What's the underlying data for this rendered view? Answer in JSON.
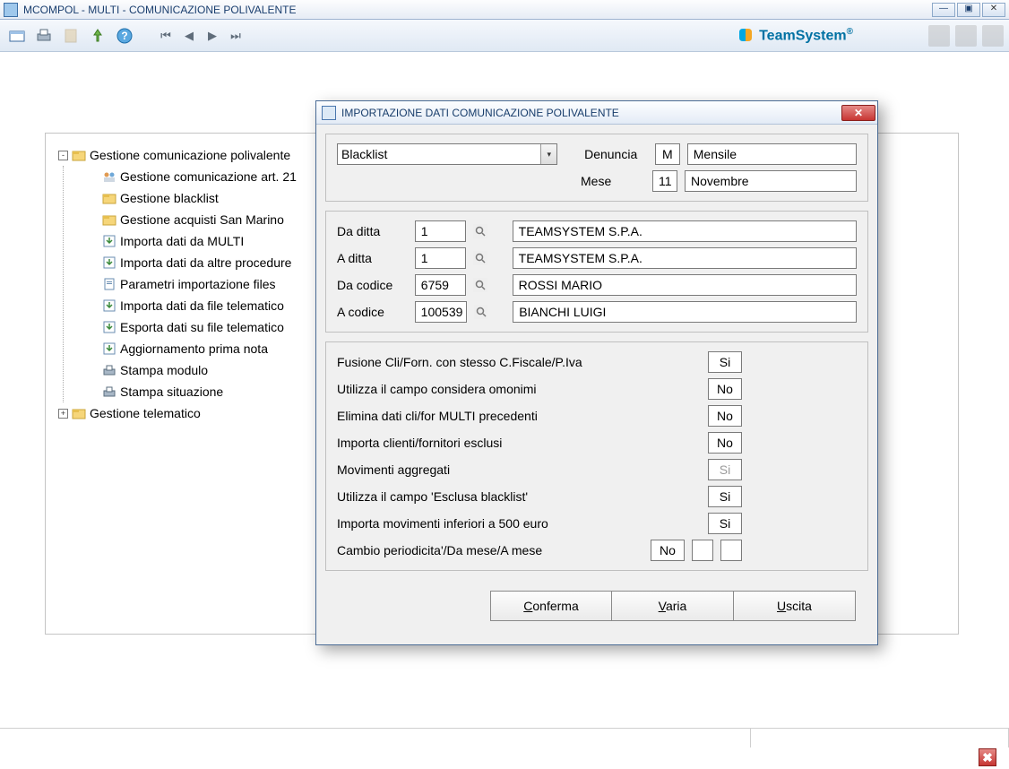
{
  "window": {
    "app_code": "MCOMPOL",
    "module": "MULTI",
    "title": "COMUNICAZIONE POLIVALENTE",
    "full_title": "MCOMPOL  - MULTI -  COMUNICAZIONE POLIVALENTE"
  },
  "brand": {
    "name": "TeamSystem",
    "mark": "®"
  },
  "tree": {
    "root1": {
      "label": "Gestione comunicazione polivalente",
      "expanded": "-",
      "children": [
        "Gestione comunicazione art. 21",
        "Gestione blacklist",
        "Gestione acquisti San Marino",
        "Importa dati da MULTI",
        "Importa dati da altre procedure",
        "Parametri importazione files",
        "Importa dati da file telematico",
        "Esporta dati su file telematico",
        "Aggiornamento prima nota",
        "Stampa modulo",
        "Stampa situazione"
      ]
    },
    "root2": {
      "label": "Gestione telematico",
      "expanded": "+"
    }
  },
  "modal": {
    "title": "IMPORTAZIONE DATI COMUNICAZIONE POLIVALENTE",
    "form": {
      "tipo_combo": "Blacklist",
      "denuncia_label": "Denuncia",
      "denuncia_code": "M",
      "denuncia_desc": "Mensile",
      "mese_label": "Mese",
      "mese_num": "11",
      "mese_desc": "Novembre",
      "da_ditta_label": "Da ditta",
      "da_ditta_val": "1",
      "da_ditta_desc": "TEAMSYSTEM S.P.A.",
      "a_ditta_label": "A ditta",
      "a_ditta_val": "1",
      "a_ditta_desc": "TEAMSYSTEM S.P.A.",
      "da_codice_label": "Da codice",
      "da_codice_val": "6759",
      "da_codice_desc": "ROSSI MARIO",
      "a_codice_label": "A codice",
      "a_codice_val": "100539",
      "a_codice_desc": "BIANCHI LUIGI"
    },
    "options": [
      {
        "label": "Fusione Cli/Forn. con stesso C.Fiscale/P.Iva",
        "value": "Si",
        "disabled": false
      },
      {
        "label": "Utilizza il campo considera omonimi",
        "value": "No",
        "disabled": false
      },
      {
        "label": "Elimina dati cli/for MULTI precedenti",
        "value": "No",
        "disabled": false
      },
      {
        "label": "Importa clienti/fornitori esclusi",
        "value": "No",
        "disabled": false
      },
      {
        "label": "Movimenti aggregati",
        "value": "Si",
        "disabled": true
      },
      {
        "label": "Utilizza il campo 'Esclusa blacklist'",
        "value": "Si",
        "disabled": false
      },
      {
        "label": "Importa movimenti inferiori a 500 euro",
        "value": "Si",
        "disabled": false
      },
      {
        "label": "Cambio periodicita'/Da mese/A mese",
        "value": "No",
        "disabled": false,
        "extra_boxes": 2
      }
    ],
    "buttons": {
      "conferma": "Conferma",
      "varia": "Varia",
      "uscita": "Uscita"
    }
  }
}
